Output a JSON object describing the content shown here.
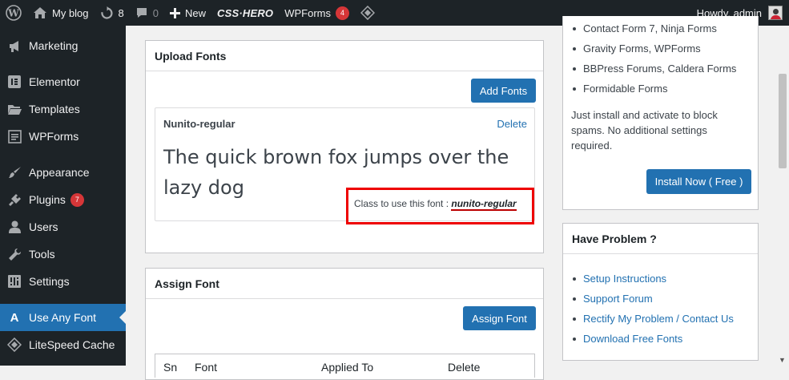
{
  "adminbar": {
    "site_name": "My blog",
    "updates_count": "8",
    "comments_count": "0",
    "new_label": "New",
    "csshero_label": "CSS·HERO",
    "wpforms_label": "WPForms",
    "wpforms_badge": "4",
    "howdy": "Howdy, admin"
  },
  "sidebar": {
    "items": [
      {
        "label": "Marketing",
        "icon": "megaphone-icon"
      },
      {
        "label": "Elementor",
        "icon": "elementor-icon"
      },
      {
        "label": "Templates",
        "icon": "folder-icon"
      },
      {
        "label": "WPForms",
        "icon": "form-icon"
      },
      {
        "label": "Appearance",
        "icon": "paintbrush-icon"
      },
      {
        "label": "Plugins",
        "icon": "plug-icon",
        "badge": "7"
      },
      {
        "label": "Users",
        "icon": "user-icon"
      },
      {
        "label": "Tools",
        "icon": "wrench-icon"
      },
      {
        "label": "Settings",
        "icon": "sliders-icon"
      },
      {
        "label": "Use Any Font",
        "icon": "letter-a-icon",
        "active": true
      },
      {
        "label": "LiteSpeed Cache",
        "icon": "diamond-icon"
      }
    ]
  },
  "upload_fonts": {
    "title": "Upload Fonts",
    "add_button": "Add Fonts",
    "font_name": "Nunito-regular",
    "delete_label": "Delete",
    "preview_text": "The quick brown fox jumps over the lazy dog",
    "class_label": "Class to use this font : ",
    "class_value": "nunito-regular"
  },
  "assign_font": {
    "title": "Assign Font",
    "assign_button": "Assign Font",
    "columns": [
      "Sn",
      "Font",
      "Applied To",
      "Delete"
    ]
  },
  "right_panel": {
    "forms_list": [
      "Contact Form 7, Ninja Forms",
      "Gravity Forms, WPForms",
      "BBPress Forums, Caldera Forms",
      "Formidable Forms"
    ],
    "install_note": "Just install and activate to block spams. No additional settings required.",
    "install_button": "Install Now ( Free )"
  },
  "have_problem": {
    "title": "Have Problem ?",
    "links": [
      "Setup Instructions",
      "Support Forum",
      "Rectify My Problem / Contact Us",
      "Download Free Fonts"
    ]
  },
  "colors": {
    "accent": "#2271b1",
    "adminbar": "#1d2327",
    "badge": "#d63638",
    "highlight": "#e00000"
  }
}
